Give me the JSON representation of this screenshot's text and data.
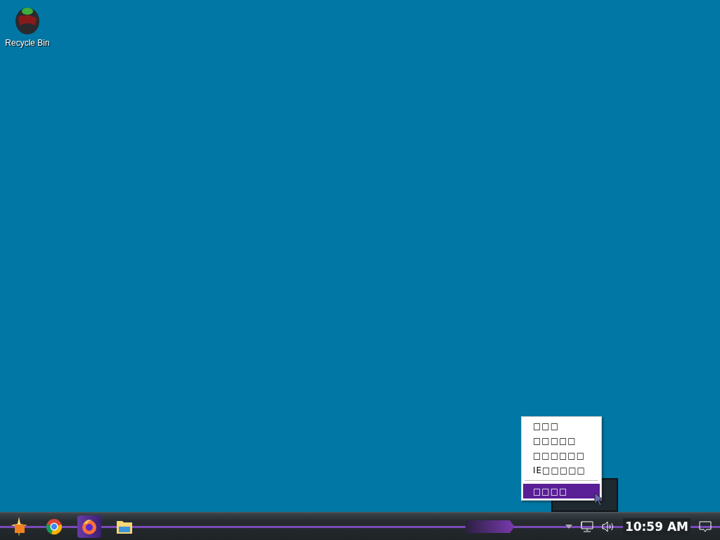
{
  "desktop": {
    "icons": [
      {
        "label": "Recycle Bin"
      }
    ]
  },
  "context_menu": {
    "items": [
      {
        "label": "□□□",
        "selected": false
      },
      {
        "label": "□□□□□",
        "selected": false
      },
      {
        "label": "□□□□□□",
        "selected": false
      },
      {
        "label": "IE□□□□□",
        "selected": false
      }
    ],
    "items_after_separator": [
      {
        "label": "□□□□",
        "selected": true
      }
    ]
  },
  "taskbar": {
    "apps": [
      {
        "kind": "start",
        "selected": false
      },
      {
        "kind": "chrome",
        "selected": false
      },
      {
        "kind": "firefox",
        "selected": true
      },
      {
        "kind": "folder",
        "selected": false
      }
    ],
    "tray": {
      "clock": "10:59 AM"
    }
  }
}
